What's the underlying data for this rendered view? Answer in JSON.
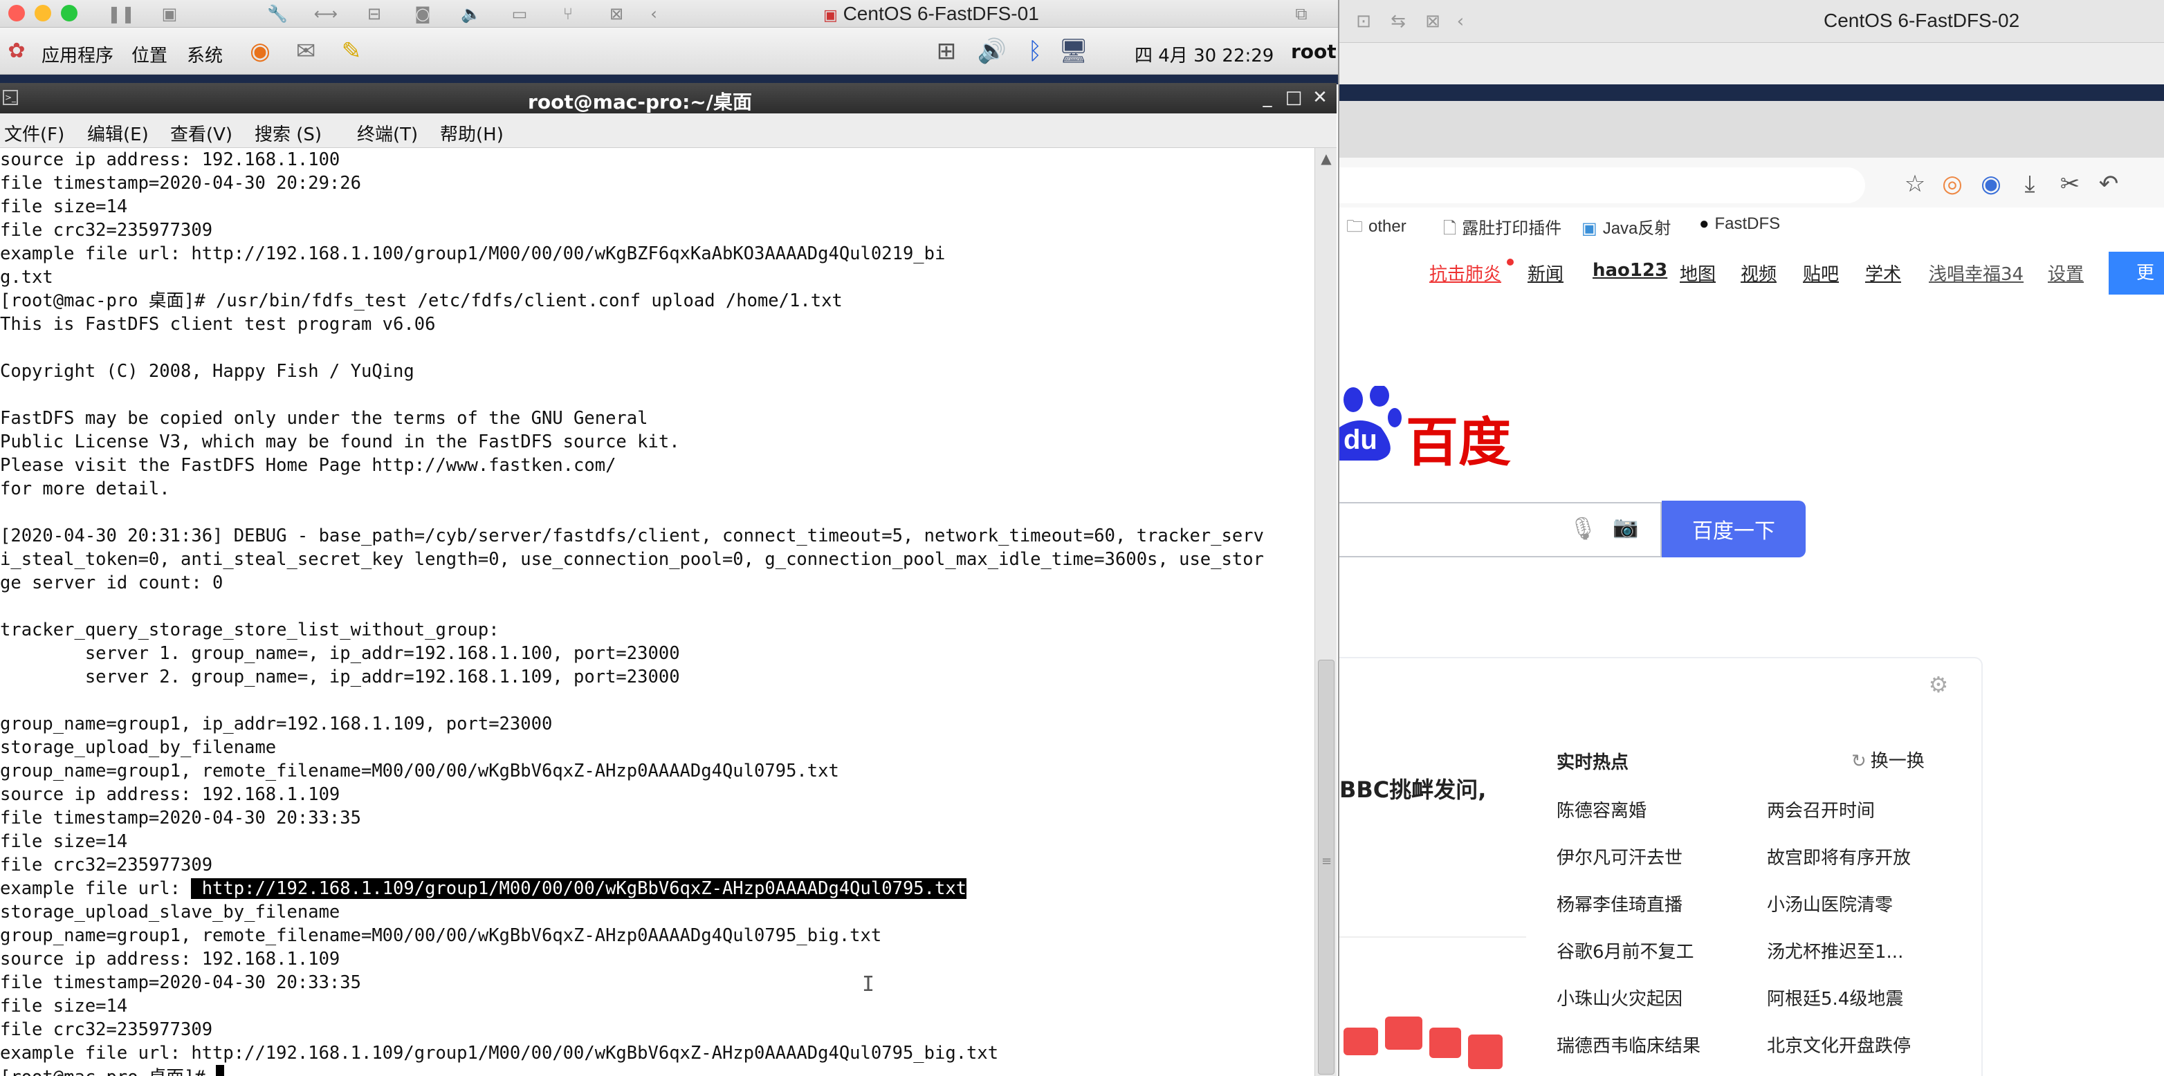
{
  "vm1": {
    "title": "CentOS 6-FastDFS-01",
    "panel": {
      "menus": [
        "应用程序",
        "位置",
        "系统"
      ],
      "clock": "四 4月 30 22:29",
      "user": "root"
    },
    "terminal": {
      "title": "root@mac-pro:~/桌面",
      "menus": [
        "文件(F)",
        "编辑(E)",
        "查看(V)",
        "搜索 (S)",
        "终端(T)",
        "帮助(H)"
      ],
      "lines": [
        "source ip address: 192.168.1.100",
        "file timestamp=2020-04-30 20:29:26",
        "file size=14",
        "file crc32=235977309",
        "example file url: http://192.168.1.100/group1/M00/00/00/wKgBZF6qxKaAbKO3AAAADg4Qul0219_bi",
        "g.txt",
        "[root@mac-pro 桌面]# /usr/bin/fdfs_test /etc/fdfs/client.conf upload /home/1.txt",
        "This is FastDFS client test program v6.06",
        "",
        "Copyright (C) 2008, Happy Fish / YuQing",
        "",
        "FastDFS may be copied only under the terms of the GNU General",
        "Public License V3, which may be found in the FastDFS source kit.",
        "Please visit the FastDFS Home Page http://www.fastken.com/",
        "for more detail.",
        "",
        "[2020-04-30 20:31:36] DEBUG - base_path=/cyb/server/fastdfs/client, connect_timeout=5, network_timeout=60, tracker_serv",
        "i_steal_token=0, anti_steal_secret_key length=0, use_connection_pool=0, g_connection_pool_max_idle_time=3600s, use_stor",
        "ge server id count: 0",
        "",
        "tracker_query_storage_store_list_without_group:",
        "        server 1. group_name=, ip_addr=192.168.1.100, port=23000",
        "        server 2. group_name=, ip_addr=192.168.1.109, port=23000",
        "",
        "group_name=group1, ip_addr=192.168.1.109, port=23000",
        "storage_upload_by_filename",
        "group_name=group1, remote_filename=M00/00/00/wKgBbV6qxZ-AHzp0AAAADg4Qul0795.txt",
        "source ip address: 192.168.1.109",
        "file timestamp=2020-04-30 20:33:35",
        "file size=14",
        "file crc32=235977309",
        "example file url: ",
        "storage_upload_slave_by_filename",
        "group_name=group1, remote_filename=M00/00/00/wKgBbV6qxZ-AHzp0AAAADg4Qul0795_big.txt",
        "source ip address: 192.168.1.109",
        "file timestamp=2020-04-30 20:33:35",
        "file size=14",
        "file crc32=235977309",
        "example file url: http://192.168.1.109/group1/M00/00/00/wKgBbV6qxZ-AHzp0AAAADg4Qul0795_big.txt",
        "[root@mac-pro 桌面]# "
      ],
      "selected_url": " http://192.168.1.109/group1/M00/00/00/wKgBbV6qxZ-AHzp0AAAADg4Qul0795.txt"
    }
  },
  "vm2": {
    "title": "CentOS 6-FastDFS-02",
    "bookmarks": [
      "other",
      "露肚打印插件",
      "Java反射",
      "FastDFS"
    ],
    "nav": [
      "抗击肺炎",
      "新闻",
      "hao123",
      "地图",
      "视频",
      "贴吧",
      "学术",
      "浅唱幸福34",
      "设置"
    ],
    "more": "更多",
    "logo": {
      "du": "du",
      "name": "百度"
    },
    "search_button": "百度一下",
    "news_headline": "BBC挑衅发问,",
    "hot": {
      "title": "实时热点",
      "refresh": "换一换",
      "left": [
        "陈德容离婚",
        "伊尔凡可汗去世",
        "杨幂李佳琦直播",
        "谷歌6月前不复工",
        "小珠山火灾起因",
        "瑞德西韦临床结果"
      ],
      "right": [
        "两会召开时间",
        "故宫即将有序开放",
        "小汤山医院清零",
        "汤尤杯推迟至1...",
        "阿根廷5.4级地震",
        "北京文化开盘跌停"
      ]
    }
  },
  "colors": {
    "accent": "#4e6ef2",
    "baidu_red": "#e10602",
    "hot_red": "#e33333"
  }
}
